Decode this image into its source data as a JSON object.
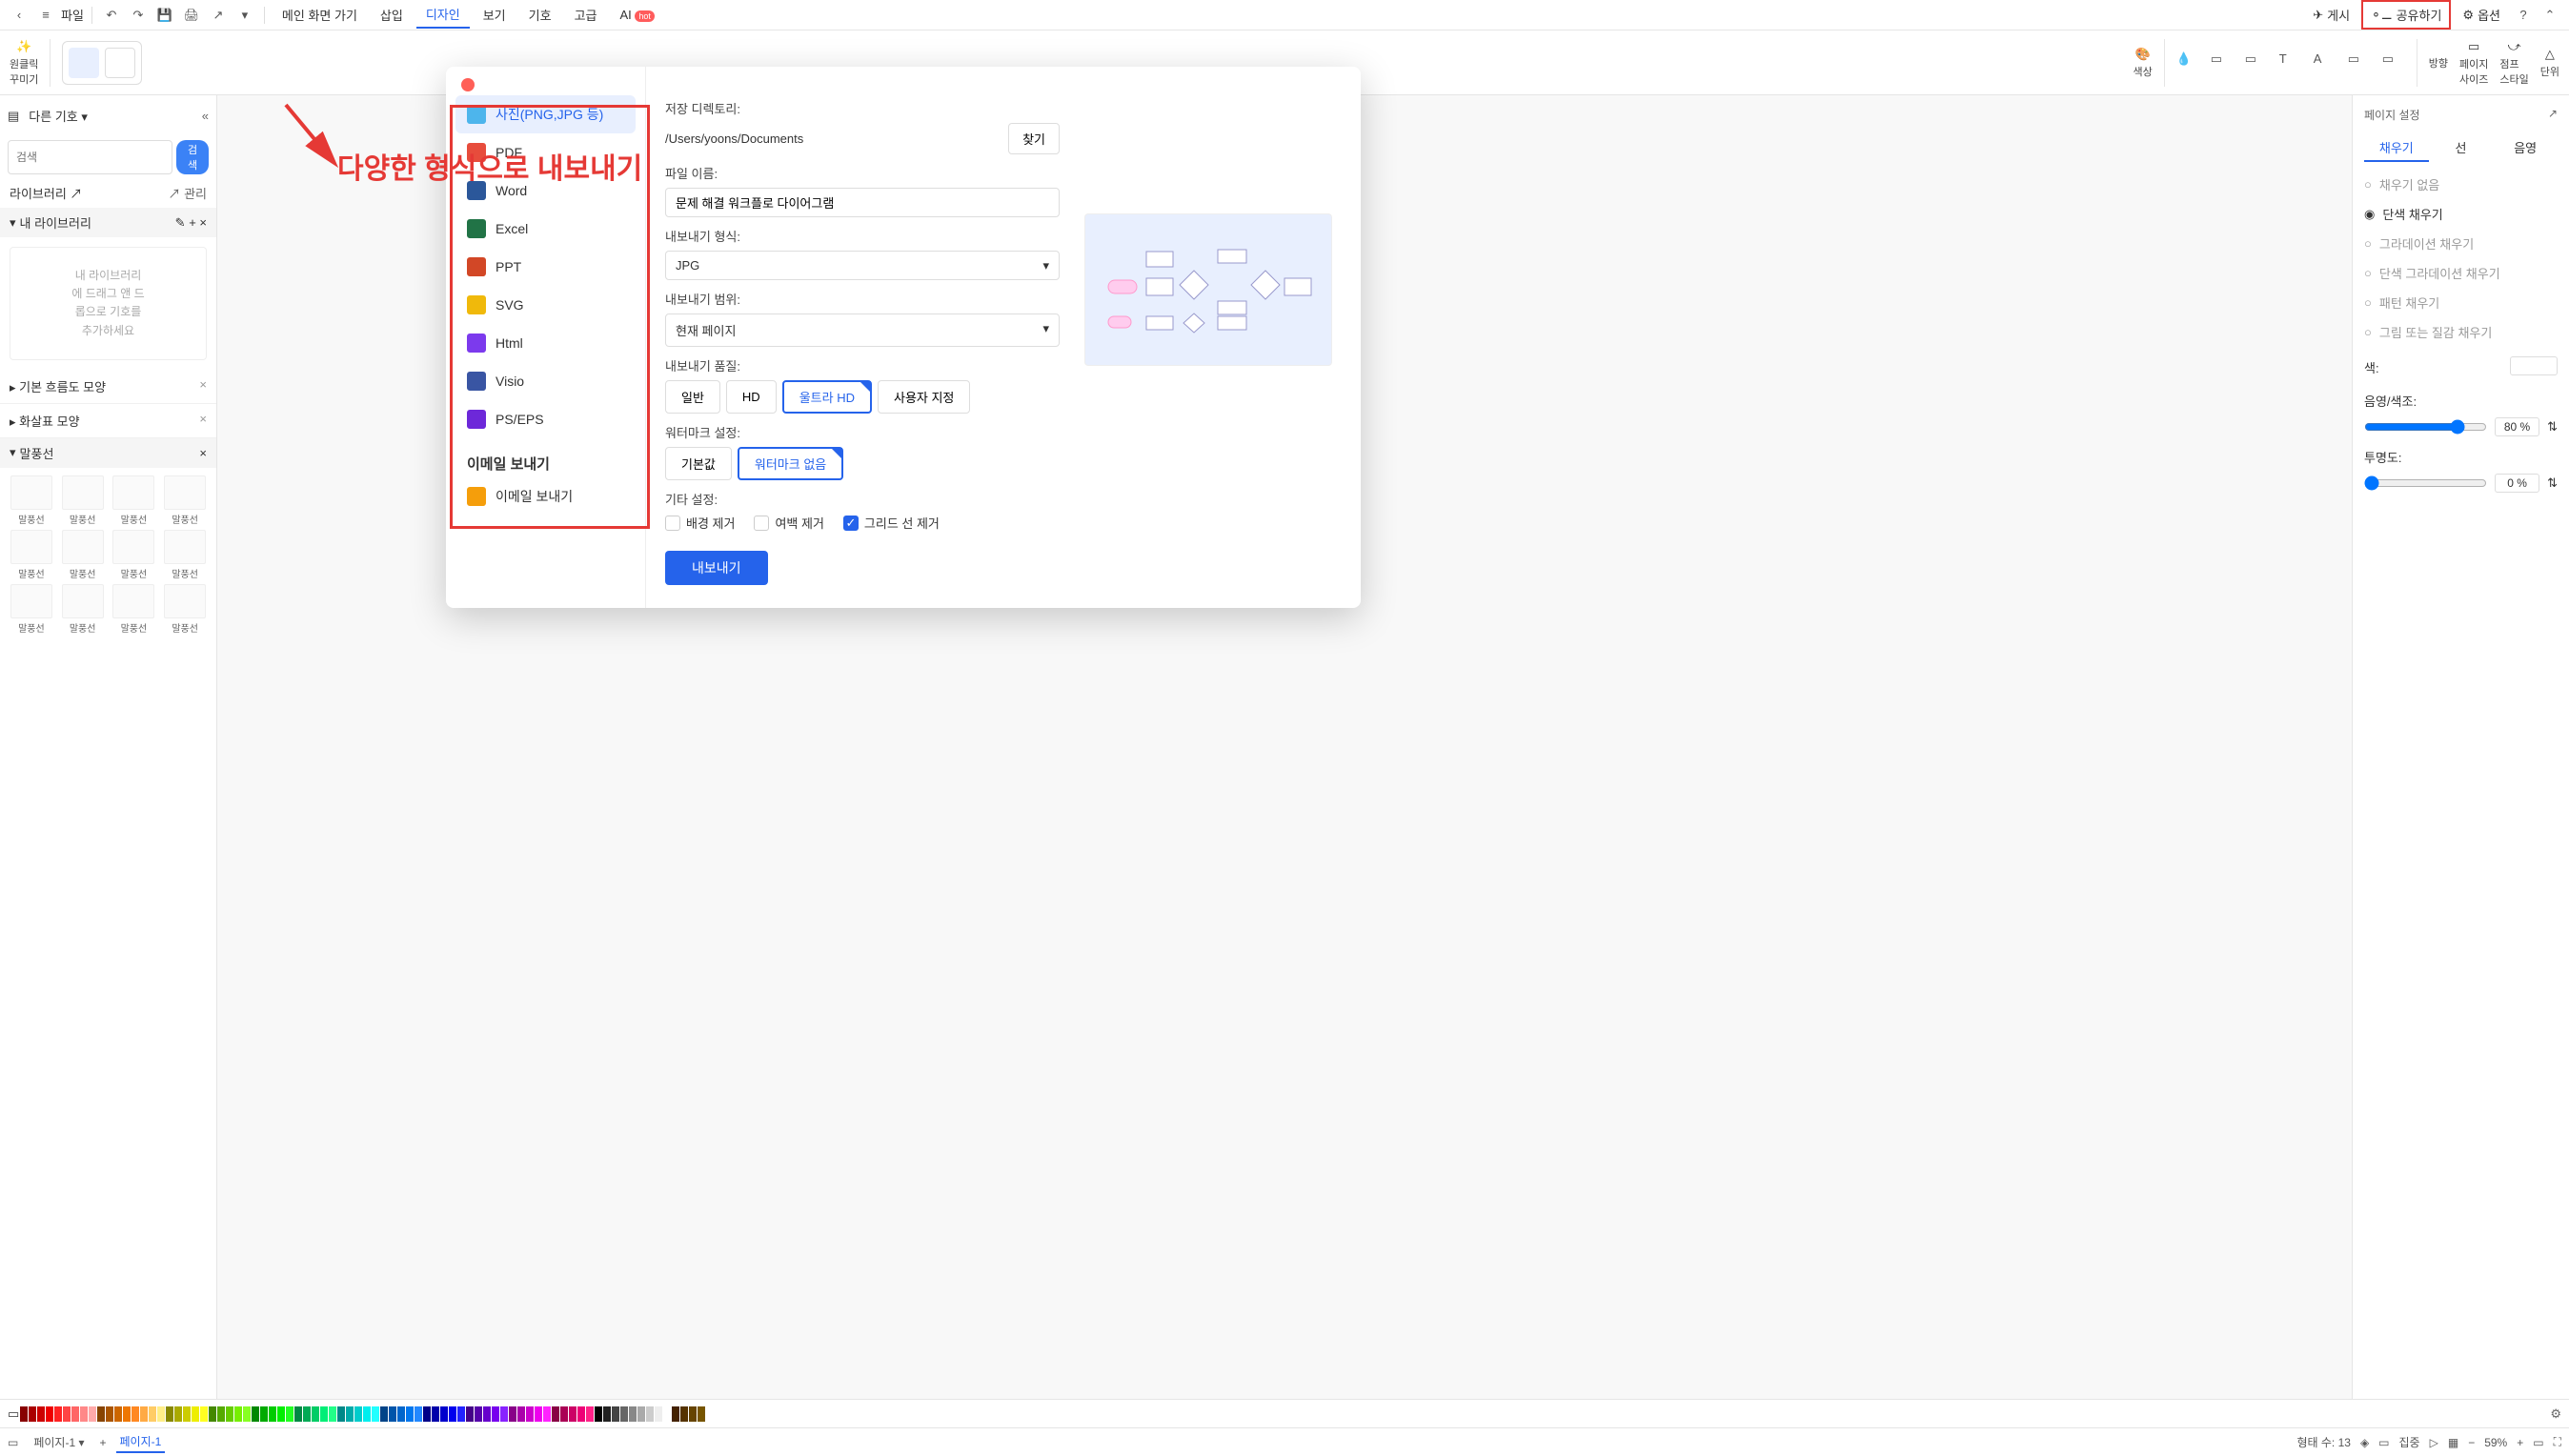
{
  "topbar": {
    "file_label": "파일",
    "tabs": {
      "home": "메인 화면 가기",
      "insert": "삽입",
      "design": "디자인",
      "view": "보기",
      "symbol": "기호",
      "advanced": "고급",
      "ai": "AI"
    },
    "hot_badge": "hot",
    "publish": "게시",
    "share": "공유하기",
    "options": "옵션"
  },
  "ribbon": {
    "oneclick": "원클릭\n꾸미기",
    "color": "색상",
    "direction": "방향",
    "page_size": "페이지\n사이즈",
    "jump_style": "점프\n스타일",
    "unit": "단위"
  },
  "sidebar": {
    "other_symbols": "다른 기호",
    "search_placeholder": "검색",
    "search_btn": "검색",
    "library_label": "라이브러리",
    "manage_label": "관리",
    "my_library": "내 라이브러리",
    "placeholder_text": "내 라이브러리\n에 드래그 앤 드\n롭으로 기호를\n추가하세요",
    "sections": {
      "basic_flow": "기본 흐름도 모양",
      "arrow": "화살표 모양",
      "callout": "말풍선"
    },
    "shape_label": "말풍선"
  },
  "right_panel": {
    "title": "페이지 설정",
    "tabs": {
      "fill": "채우기",
      "line": "선",
      "shadow": "음영"
    },
    "fill_opts": {
      "none": "채우기 없음",
      "solid": "단색 채우기",
      "gradient": "그라데이션 채우기",
      "solid_gradient": "단색 그라데이션 채우기",
      "pattern": "패턴 채우기",
      "picture": "그림 또는 질감 채우기"
    },
    "color_label": "색:",
    "tint_label": "음영/색조:",
    "tint_value": "80 %",
    "opacity_label": "투명도:",
    "opacity_value": "0 %"
  },
  "dialog": {
    "formats": {
      "image": "사진(PNG,JPG 등)",
      "pdf": "PDF",
      "word": "Word",
      "excel": "Excel",
      "ppt": "PPT",
      "svg": "SVG",
      "html": "Html",
      "visio": "Visio",
      "pseps": "PS/EPS"
    },
    "email_header": "이메일 보내기",
    "email_send": "이메일 보내기",
    "save_dir_label": "저장 디렉토리:",
    "save_dir_value": "/Users/yoons/Documents",
    "browse": "찾기",
    "filename_label": "파일 이름:",
    "filename_value": "문제 해결 워크플로 다이어그램",
    "format_label": "내보내기 형식:",
    "format_value": "JPG",
    "range_label": "내보내기 범위:",
    "range_value": "현재 페이지",
    "quality_label": "내보내기 품질:",
    "quality": {
      "normal": "일반",
      "hd": "HD",
      "ultra": "울트라 HD",
      "custom": "사용자 지정"
    },
    "watermark_label": "워터마크 설정:",
    "watermark": {
      "default": "기본값",
      "none": "워터마크 없음"
    },
    "other_label": "기타 설정:",
    "checks": {
      "bg": "배경 제거",
      "margin": "여백 제거",
      "grid": "그리드 선 제거"
    },
    "export_btn": "내보내기"
  },
  "annotation": {
    "text": "다양한 형식으로 내보내기"
  },
  "statusbar": {
    "page_select": "페이지-1",
    "page_tab": "페이지-1",
    "shape_count": "형태 수: 13",
    "focus": "집중",
    "zoom": "59%"
  }
}
